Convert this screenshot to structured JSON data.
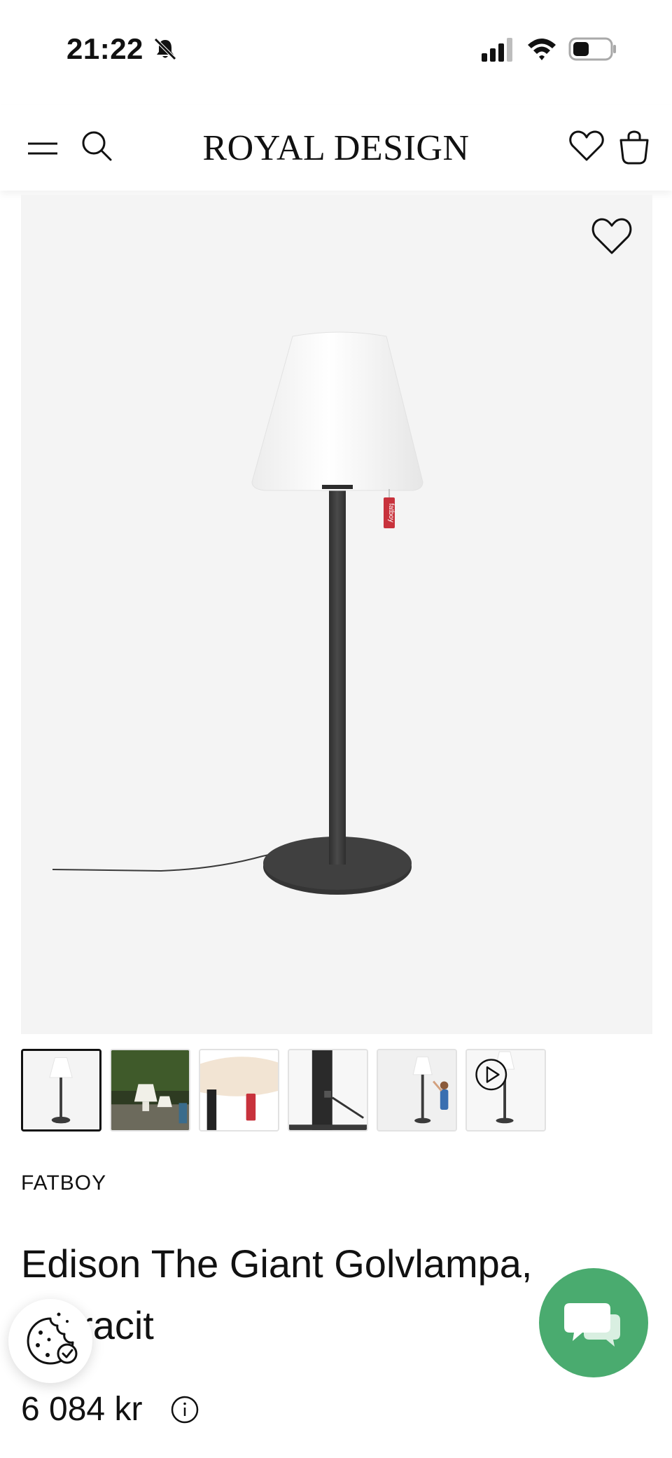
{
  "status_bar": {
    "time": "21:22",
    "icons": [
      "bell-slash-icon",
      "signal-icon",
      "wifi-icon",
      "battery-icon"
    ]
  },
  "header": {
    "logo": "ROYAL DESIGN",
    "icons": [
      "menu-icon",
      "search-icon",
      "heart-icon",
      "bag-icon"
    ]
  },
  "product": {
    "brand": "FATBOY",
    "title": "Edison The Giant Golvlampa, Antracit",
    "price": "6 084 kr",
    "tag_text": "fatboy"
  },
  "thumbnails": [
    {
      "name": "lamp-front",
      "active": true
    },
    {
      "name": "garden-lamps",
      "active": false
    },
    {
      "name": "lamp-top-detail",
      "active": false
    },
    {
      "name": "lamp-pole-detail",
      "active": false
    },
    {
      "name": "lamp-with-child",
      "active": false
    },
    {
      "name": "lamp-video",
      "active": false,
      "video": true
    }
  ],
  "colors": {
    "chat_green": "#4aab6f",
    "lamp_dark": "#3b3b3b",
    "image_bg": "#f4f4f4",
    "tag_red": "#c8323c"
  }
}
